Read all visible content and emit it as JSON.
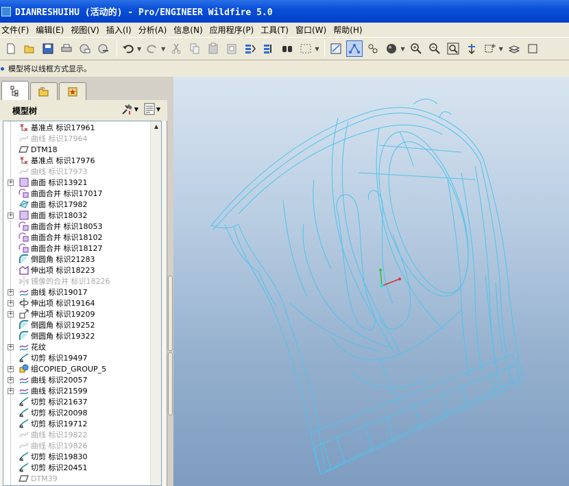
{
  "window": {
    "title": "DIANRESHUIHU (活动的) - Pro/ENGINEER Wildfire 5.0"
  },
  "menu": [
    "文件(F)",
    "编辑(E)",
    "视图(V)",
    "插入(I)",
    "分析(A)",
    "信息(N)",
    "应用程序(P)",
    "工具(T)",
    "窗口(W)",
    "帮助(H)"
  ],
  "message": {
    "text": "模型将以线框方式显示。"
  },
  "panel": {
    "title": "模型树"
  },
  "tree": {
    "items": [
      {
        "label": "基准点 标识17961",
        "icon": "datum-point-icon",
        "dim": false,
        "expandable": false
      },
      {
        "label": "曲线 标识17964",
        "icon": "curve-icon",
        "dim": true,
        "expandable": false
      },
      {
        "label": "DTM18",
        "icon": "datum-plane-icon",
        "dim": false,
        "expandable": false
      },
      {
        "label": "基准点 标识17976",
        "icon": "datum-point-icon",
        "dim": false,
        "expandable": false
      },
      {
        "label": "曲线 标识17973",
        "icon": "curve-icon",
        "dim": true,
        "expandable": false
      },
      {
        "label": "曲面 标识13921",
        "icon": "surface-icon",
        "dim": false,
        "expandable": true
      },
      {
        "label": "曲面合并 标识17017",
        "icon": "merge-icon",
        "dim": false,
        "expandable": false
      },
      {
        "label": "曲面 标识17982",
        "icon": "boundary-surface-icon",
        "dim": false,
        "expandable": false
      },
      {
        "label": "曲面 标识18032",
        "icon": "surface-icon",
        "dim": false,
        "expandable": true
      },
      {
        "label": "曲面合并 标识18053",
        "icon": "merge-icon",
        "dim": false,
        "expandable": false
      },
      {
        "label": "曲面合并 标识18102",
        "icon": "merge-icon",
        "dim": false,
        "expandable": false
      },
      {
        "label": "曲面合并 标识18127",
        "icon": "merge-icon",
        "dim": false,
        "expandable": false
      },
      {
        "label": "倒圆角 标识21283",
        "icon": "round-icon",
        "dim": false,
        "expandable": false
      },
      {
        "label": "伸出项 标识18223",
        "icon": "protrusion-icon",
        "dim": false,
        "expandable": false
      },
      {
        "label": "镜像的合并 标识18226",
        "icon": "mirror-icon",
        "dim": true,
        "expandable": false
      },
      {
        "label": "曲线 标识19017",
        "icon": "sketch-curve-icon",
        "dim": false,
        "expandable": true
      },
      {
        "label": "伸出项 标识19164",
        "icon": "revolve-icon",
        "dim": false,
        "expandable": true
      },
      {
        "label": "伸出项 标识19209",
        "icon": "extrude-icon",
        "dim": false,
        "expandable": true
      },
      {
        "label": "倒圆角 标识19252",
        "icon": "round-icon",
        "dim": false,
        "expandable": false
      },
      {
        "label": "倒圆角 标识19322",
        "icon": "round-icon",
        "dim": false,
        "expandable": false
      },
      {
        "label": "花纹",
        "icon": "sketch-curve-icon",
        "dim": false,
        "expandable": true
      },
      {
        "label": "切剪 标识19497",
        "icon": "cut-icon",
        "dim": false,
        "expandable": false
      },
      {
        "label": "组COPIED_GROUP_5",
        "icon": "group-icon",
        "dim": false,
        "expandable": true
      },
      {
        "label": "曲线 标识20057",
        "icon": "sketch-curve-icon",
        "dim": false,
        "expandable": true
      },
      {
        "label": "曲线 标识21599",
        "icon": "sketch-curve-icon",
        "dim": false,
        "expandable": true
      },
      {
        "label": "切剪 标识21637",
        "icon": "cut-icon",
        "dim": false,
        "expandable": false
      },
      {
        "label": "切剪 标识20098",
        "icon": "cut-icon",
        "dim": false,
        "expandable": false
      },
      {
        "label": "切剪 标识19712",
        "icon": "cut-icon",
        "dim": false,
        "expandable": false
      },
      {
        "label": "曲线 标识19822",
        "icon": "curve-icon",
        "dim": true,
        "expandable": false
      },
      {
        "label": "曲线 标识19826",
        "icon": "curve-icon",
        "dim": true,
        "expandable": false
      },
      {
        "label": "切剪 标识19830",
        "icon": "cut-icon",
        "dim": false,
        "expandable": false
      },
      {
        "label": "切剪 标识20451",
        "icon": "cut-icon",
        "dim": false,
        "expandable": false
      },
      {
        "label": "DTM39",
        "icon": "datum-plane-icon",
        "dim": true,
        "expandable": false
      }
    ]
  },
  "toolbar": {
    "buttons": [
      "new-icon",
      "open-icon",
      "save-icon",
      "print-icon",
      "send-mail-icon",
      "send-link-icon",
      "undo-icon",
      "redo-icon",
      "cut-icon",
      "copy-icon",
      "paste-icon",
      "paste-special-icon",
      "regenerate-icon",
      "regen-manager-icon",
      "find-icon",
      "select-box-icon",
      "refit-icon",
      "wireframe-icon",
      "hidden-line-icon",
      "shading-icon",
      "zoom-in-icon",
      "zoom-out-icon",
      "zoom-fit-icon",
      "reorient-icon",
      "saved-views-icon",
      "layers-icon",
      "more-icon"
    ]
  },
  "colors": {
    "titlebar": "#0a4fd8",
    "wireframe": "#4ec3ee",
    "accent": "#316ac5"
  }
}
